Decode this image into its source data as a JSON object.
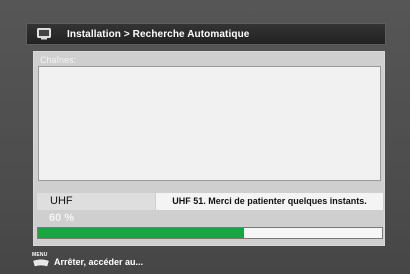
{
  "header": {
    "icon": "tv-icon",
    "title": "Installation > Recherche Automatique"
  },
  "panel": {
    "channels_label": "Chaînes:",
    "channels": []
  },
  "status": {
    "band": "UHF",
    "message": "UHF 51.  Merci de patienter quelques instants.",
    "progress_text": "60 %",
    "progress_fraction": 0.6,
    "progress_color": "#18a642"
  },
  "footer": {
    "key_label": "MENU",
    "key_icon": "remote-key-icon",
    "hint": "Arrêter, accéder au..."
  }
}
